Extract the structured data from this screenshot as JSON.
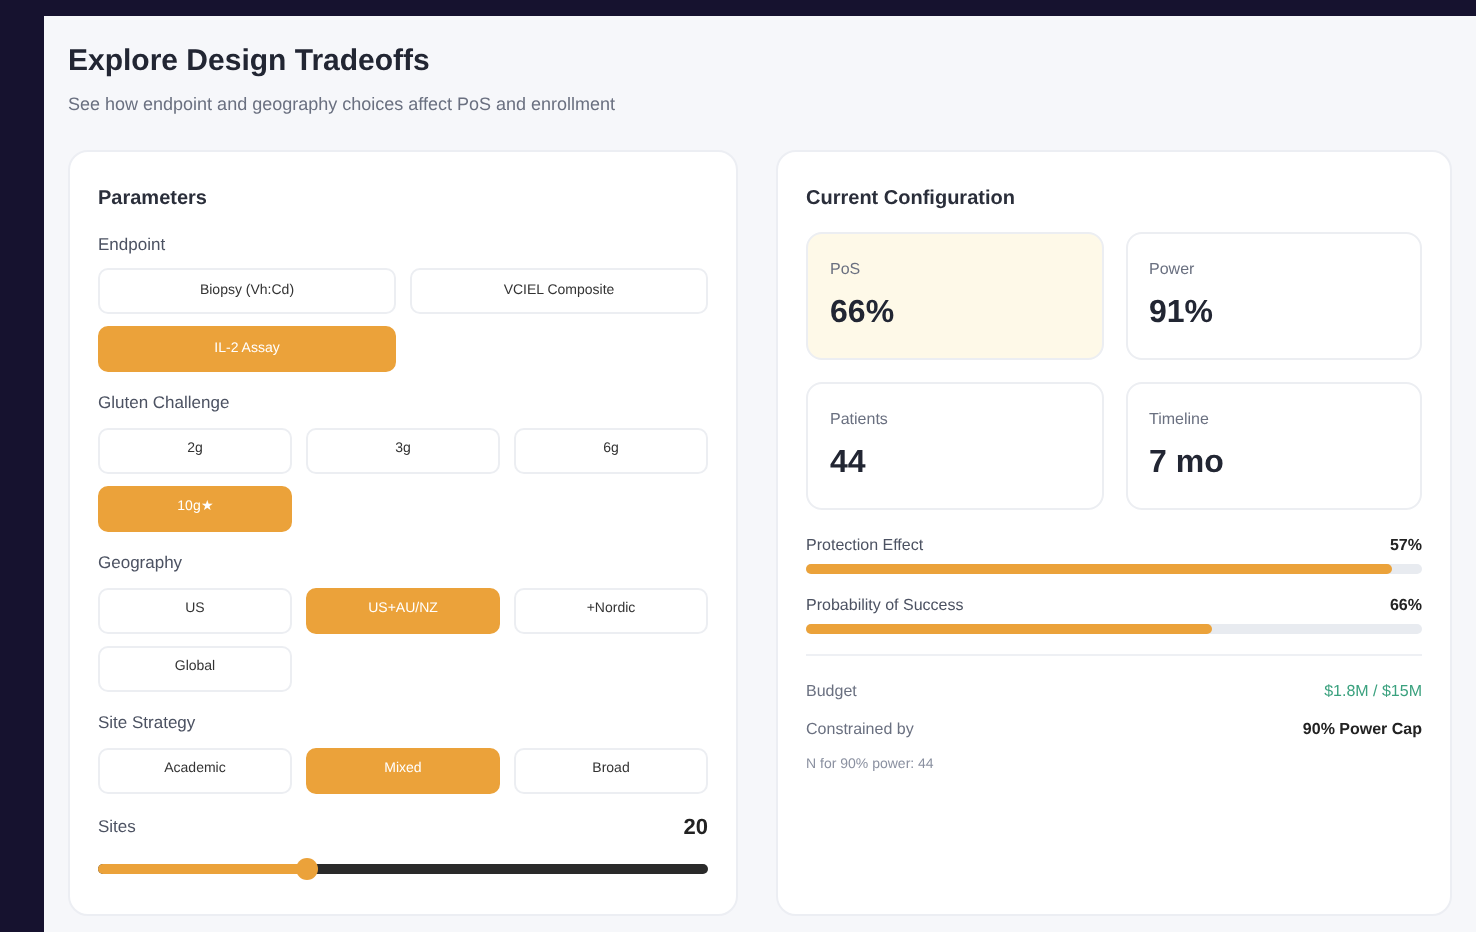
{
  "title": "Explore Design Tradeoffs",
  "subtitle": "See how endpoint and geography choices affect PoS and enrollment",
  "parameters": {
    "heading": "Parameters",
    "groups": [
      {
        "label": "Endpoint",
        "options": [
          {
            "label": "Biopsy (Vh:Cd)",
            "selected": false
          },
          {
            "label": "VCIEL Composite",
            "selected": false
          },
          {
            "label": "IL-2 Assay",
            "selected": true
          }
        ]
      },
      {
        "label": "Gluten Challenge",
        "options": [
          {
            "label": "2g",
            "selected": false
          },
          {
            "label": "3g",
            "selected": false
          },
          {
            "label": "6g",
            "selected": false
          },
          {
            "label": "10g★",
            "selected": true
          }
        ]
      },
      {
        "label": "Geography",
        "options": [
          {
            "label": "US",
            "selected": false
          },
          {
            "label": "US+AU/NZ",
            "selected": true
          },
          {
            "label": "+Nordic",
            "selected": false
          },
          {
            "label": "Global",
            "selected": false
          }
        ]
      },
      {
        "label": "Site Strategy",
        "options": [
          {
            "label": "Academic",
            "selected": false
          },
          {
            "label": "Mixed",
            "selected": true
          },
          {
            "label": "Broad",
            "selected": false
          }
        ]
      }
    ],
    "slider": {
      "label": "Sites",
      "reading": "20",
      "level": 0.34
    }
  },
  "configuration": {
    "heading": "Current Configuration",
    "metrics": [
      {
        "label": "PoS",
        "value": "66%",
        "highlighted": true
      },
      {
        "label": "Power",
        "value": "91%",
        "highlighted": false
      },
      {
        "label": "Patients",
        "value": "44",
        "highlighted": false
      },
      {
        "label": "Timeline",
        "value": "7 mo",
        "highlighted": false
      }
    ],
    "bars": [
      {
        "label": "Protection Effect",
        "reading": "57%",
        "level": 0.95
      },
      {
        "label": "Probability of Success",
        "reading": "66%",
        "level": 0.66
      }
    ],
    "budget": {
      "label": "Budget",
      "value": "$1.8M / $15M"
    },
    "constraint": {
      "label": "Constrained by",
      "value": "90% Power Cap"
    },
    "note": "N for 90% power: 44"
  }
}
